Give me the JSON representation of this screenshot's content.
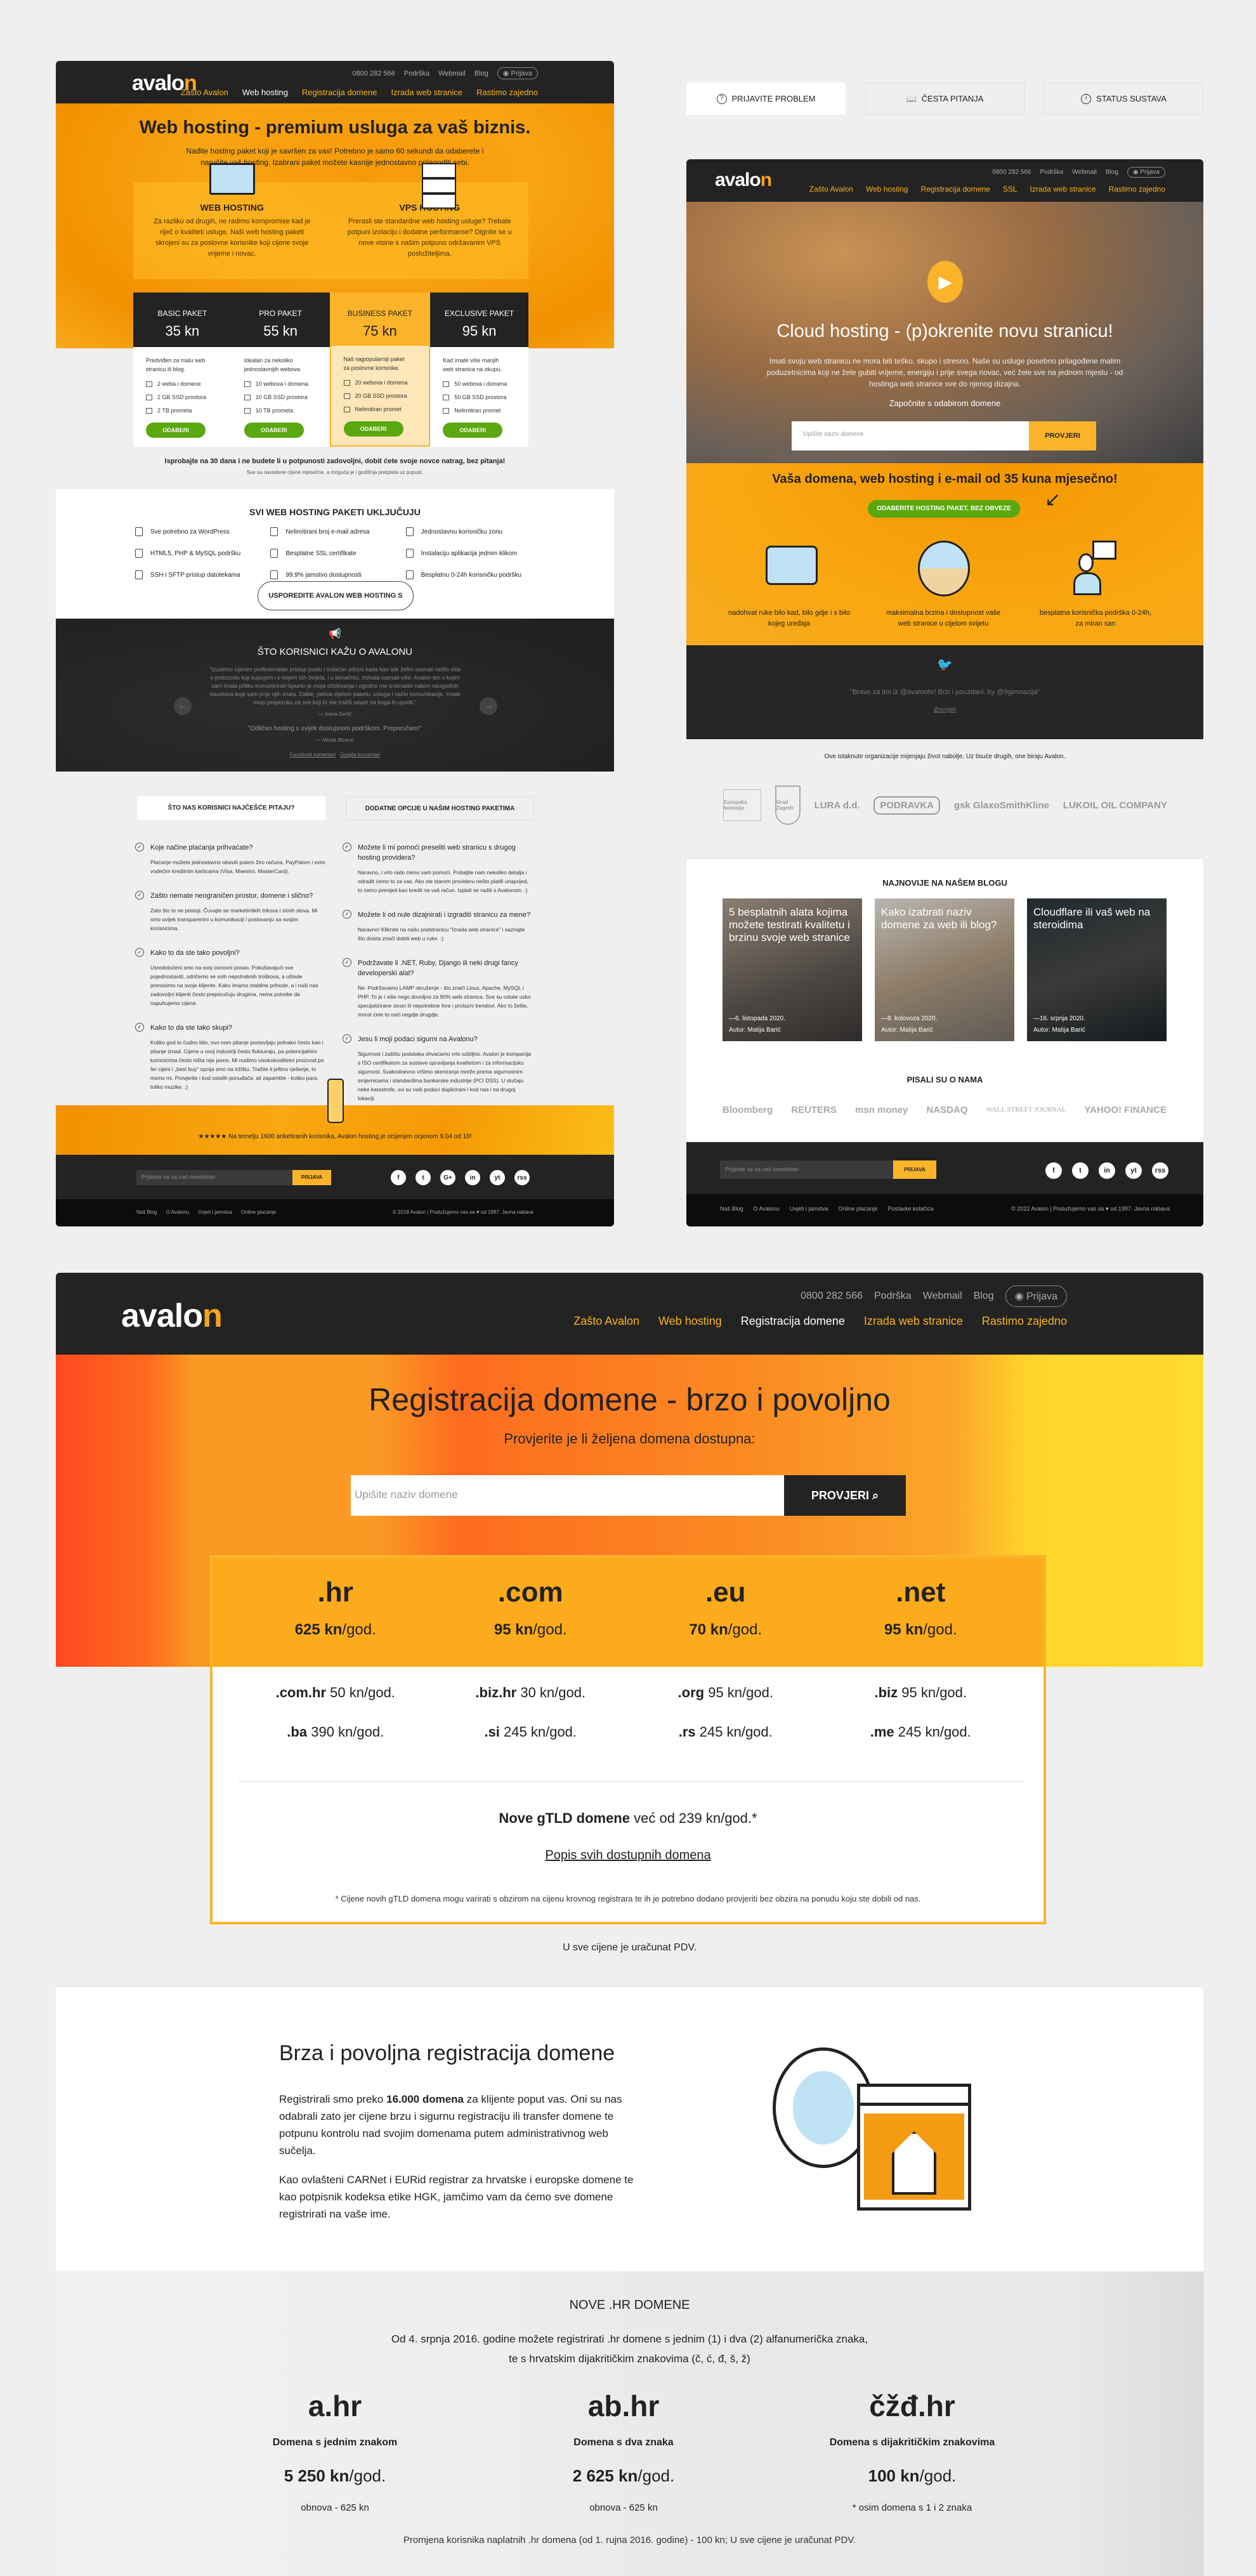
{
  "colors": {
    "brand_orange": "#f9a51a",
    "dark": "#232323",
    "green": "#5aa80f",
    "page_bg": "#efefef"
  },
  "panel_hosting": {
    "header": {
      "logo_a": "avalo",
      "logo_b": "n",
      "phone": "0800 282 566",
      "links": [
        "Podrška",
        "Webmail",
        "Blog"
      ],
      "login": "Prijava",
      "nav": [
        "Zašto Avalon",
        "Web hosting",
        "Registracija domene",
        "Izrada web stranice",
        "Rastimo zajedno"
      ],
      "active": 1
    },
    "title": "Web hosting - premium usluga za vaš biznis.",
    "subtitle": "Nađite hosting paket koji je savršen za vas! Potrebno je samo 60 sekundi da odaberete i naručite vaš hosting. Izabrani paket možete kasnije jednostavno prilagoditi sebi.",
    "options": [
      {
        "title": "WEB HOSTING",
        "text": "Za razliku od drugih, ne radimo kompromise kad je riječ o kvaliteti usluge. Naši web hosting paketi skrojeni su za poslovne korisnike koji cijene svoje vrijeme i novac.",
        "icon": "devices-icon"
      },
      {
        "title": "VPS HOSTING",
        "text": "Prerasli ste standardne web hosting usluge? Trebate potpuni izolaciju i dodatne performanse? Dignite se u nove visine s našim potpuno održavanim VPS poslužiteljima.",
        "icon": "server-icon"
      }
    ],
    "plans": [
      {
        "name": "BASIC PAKET",
        "price": "35 kn",
        "desc": "Predviđen za malu web stranicu ili blog.",
        "features": [
          "2 weba i domene",
          "2 GB SSD prostora",
          "2 TB prometa"
        ],
        "button": "ODABERI",
        "highlighted": false
      },
      {
        "name": "PRO PAKET",
        "price": "55 kn",
        "desc": "Idealan za nekoliko jednostavnijih webova.",
        "features": [
          "10 webova i domena",
          "10 GB SSD prostora",
          "10 TB prometa"
        ],
        "button": "ODABERI",
        "highlighted": false
      },
      {
        "name": "BUSINESS PAKET",
        "price": "75 kn",
        "desc": "Naš najpopularniji paket za poslovne korisnike.",
        "features": [
          "20 webova i domena",
          "20 GB SSD prostora",
          "Nelimitiran promet"
        ],
        "button": "ODABERI",
        "highlighted": true
      },
      {
        "name": "EXCLUSIVE PAKET",
        "price": "95 kn",
        "desc": "Kad imate više manjih web stranica na okupu.",
        "features": [
          "50 webova i domena",
          "50 GB SSD prostora",
          "Nelimitiran promet"
        ],
        "button": "ODABERI",
        "highlighted": false
      }
    ],
    "guarantee": "Isprobajte na 30 dana i ne budete li u potpunosti zadovoljni, dobit ćete svoje novce natrag, bez pitanja!",
    "note": "Sve su navedene cijene mjesečne, a moguća je i godišnja pretplata uz popust."
  },
  "panel_features": {
    "title": "SVI WEB HOSTING PAKETI UKLJUČUJU",
    "items": [
      "Sve potrebno za WordPress",
      "Nelimitirani broj e-mail adresa",
      "Jednostavnu korisničku zonu",
      "HTML5, PHP & MySQL podršku",
      "Besplatne SSL certifikate",
      "Instalaciju aplikacija jednim klikom",
      "SSH i SFTP pristup datotekama",
      "99,9% jamstvo dostupnosti",
      "Besplatnu 0-24h korisničku podršku"
    ],
    "compare_button": "USPOREDITE AVALON WEB HOSTING S DRUGIMA",
    "testimonials_title": "ŠTO KORISNICI KAŽU O AVALONU",
    "quote1": "\"Izuzetno cijenim profesionalan pristup poslu i srdačan odnos kada kao laik želim saznati nešto više o proizvodu koji kupujem i o kojem bih željela, i u konačnici, trebala saznati više. Avalon tim s kojim sam imala priliku komunicirati ispunio je moja očekivanja i ugodno me iznenadio nakon neugodnih iskustava koje sam prije njih imala. Dakle, petica cijelom paketu: usluga i način komunikacije. Imate moju preporuku za sve koji bi me tražili savjet na koga ih uputiti.\"",
    "author1": "— Ivana Sertić",
    "quote2": "\"Odličan hosting s uvijek dostupnom podrškom. Preporučam!\"",
    "author2": "— Nikola Bicanic",
    "fb_link": "Facebook komentari",
    "g_link": "Google komentari"
  },
  "support_buttons": [
    "PRIJAVITE PROBLEM",
    "ČESTA PITANJA",
    "STATUS SUSTAVA"
  ],
  "panel_cloud": {
    "header": {
      "logo_a": "avalo",
      "logo_b": "n",
      "phone": "0800 282 566",
      "links": [
        "Podrška",
        "Webmail",
        "Blog"
      ],
      "login": "Prijava",
      "nav": [
        "Zašto Avalon",
        "Web hosting",
        "Registracija domene",
        "SSL",
        "Izrada web stranice",
        "Rastimo zajedno"
      ]
    },
    "title": "Cloud hosting - (p)okrenite novu stranicu!",
    "text": "Imati svoju web stranicu ne mora biti teško, skupo i stresno. Naše su usluge posebno prilagođene malim poduzetnicima koji ne žele gubiti vrijeme, energiju i prije svega novac, već žele sve na jednom mjestu - od hostinga web stranice sve do njenog dizajna.",
    "label": "Započnite s odabirom domene",
    "placeholder": "Upišite naziv domene",
    "check": "PROVJERI",
    "promo": "Vaša domena, web hosting i e-mail od 35 kuna mjesečno!",
    "promo_button": "ODABERITE HOSTING PAKET, BEZ OBVEZE",
    "benefits": [
      "nadohvat ruke bilo kad, bilo gdje i s bilo kojeg uređaja",
      "maksimalna brzina i dostupnost vaše web stranice u cijelom svijetu",
      "besplatna korisnička podrška 0-24h, za miran san"
    ],
    "tweet": "\"Bravo za tim iz @avalonhr! Brzi i pouzdani. by @9gimnazija\"",
    "handle": "@sonjalr"
  },
  "clients": {
    "text": "Ove istaknute organizacije mijenjaju život nabolje. Uz tisuće drugih, one biraju Avalon.",
    "logos": [
      "Europska komisija",
      "Grad Zagreb",
      "LURA d.d.",
      "PODRAVKA",
      "gsk GlaxoSmithKline",
      "LUKOIL OIL COMPANY"
    ]
  },
  "blog": {
    "title": "NAJNOVIJE NA NAŠEM BLOGU",
    "posts": [
      {
        "title": "5 besplatnih alata kojima možete testirati kvalitetu i brzinu svoje web stranice",
        "date": "—6. listopada 2020.",
        "author": "Autor: Matija Barić"
      },
      {
        "title": "Kako izabrati naziv domene za web ili blog?",
        "date": "—8. kolovoza 2020.",
        "author": "Autor: Matija Barić"
      },
      {
        "title": "Cloudflare ili vaš web na steroidima",
        "date": "—16. srpnja 2020.",
        "author": "Autor: Matija Barić"
      }
    ],
    "press_title": "PISALI SU O NAMA",
    "press": [
      "Bloomberg",
      "REUTERS",
      "msn money",
      "NASDAQ",
      "WALL STREET JOURNAL",
      "YAHOO! FINANCE"
    ],
    "footer": {
      "placeholder": "Prijavite se za naš newsletter",
      "button": "PRIJAVA",
      "social": [
        "f",
        "t",
        "in",
        "yt",
        "rss"
      ],
      "links": [
        "Naš Blog",
        "O Avalonu",
        "Uvjeti i jamstva",
        "Online plaćanje",
        "Postavke kolačića"
      ],
      "copyright": "© 2022 Avalon | Poslužujemo vas sa ♥ od 1997.  Javna nabava"
    }
  },
  "panel_faq": {
    "tabs": [
      "ŠTO NAS KORISNICI NAJČEŠĆE PITAJU?",
      "DODATNE OPCIJE U NAŠIM HOSTING PAKETIMA"
    ],
    "left": [
      {
        "q": "Koje načine plaćanja prihvaćate?",
        "a": "Plaćanje možete jednostavno obaviti putem žiro računa, PayPalom i svim vodećim kreditnim karticama (Visa, Maestro, MasterCard)."
      },
      {
        "q": "Zašto nemate neograničen prostor, domene i slično?",
        "a": "Zato što to ne postoji. Čuvajte se marketinških trikova i sitnih slova. Mi smo uvijek transparentni u komunikaciji i poslovanju sa svojim korisnicima."
      },
      {
        "q": "Kako to da ste tako povoljni?",
        "a": "Usredotočeni smo na svoj osnovni posao. Pokušavajući sve pojednostaviti, odričemo se svih nepotrebnih troškova, a uštede prenosimo na svoje klijente. Kako imamo stabilne prihode, a i naši nas zadovoljni klijenti često preporučuju drugima, nema potrebe da napuhujemo cijene."
      },
      {
        "q": "Kako to da ste tako skupi?",
        "a": "Koliko god to čudno bilo, ovo nam pitanje postavljaju jednako često kao i pitanje iznad. Cijene u ovoj industriji često fluktuiraju, pa potencijalnim korisnicima često ništa nije jasno. Mi nudimo visokokvalitetni proizvod po fer cijeni i „best buy” opcija smo na tržištu. Tražite li jeftino rješenje, to nismo mi. Provjerite i kod ostalih ponuđača, ali zapamtite - koliko para, toliko muzike. ;)"
      }
    ],
    "right": [
      {
        "q": "Možete li mi pomoći preseliti web stranicu s drugog hosting providera?",
        "a": "Naravno, i vrlo rado ćemo vam pomoći. Pošaljite nam nekoliko detalja i odradit ćemo to za vas. Ako ste starom provideru nešto platili unaprijed, to ćemo prenijeti kao kredit na vaš račun. Isplati se raditi s Avalonom. :)"
      },
      {
        "q": "Možete li od nule dizajnirati i izgraditi stranicu za mene?",
        "a": "Naravno! Kliknite na našu podstranicu \"Izrada web stranice\" i saznajte što doista znači dobiti web u ruke. :)"
      },
      {
        "q": "Podržavate li .NET, Ruby, Django ili neki drugi fancy developerski alat?",
        "a": "Ne. Podržavamo LAMP okruženje - što znači Linux, Apache, MySQL i PHP. To je i više nego dovoljno za 90% web stranica. Sve su ostale usko specijalizirane stvari ili nepotrebne fore i prolazni trendovi. Ako to želite, morat ćete to naći negdje drugdje."
      },
      {
        "q": "Jesu li moji podaci sigurni na Avalonu?",
        "a": "Sigurnost i zaštitu podataka shvaćamo vrlo ozbiljno. Avalon je kompanija s ISO certifikatom za sustave upravljanja kvalitetom i za informacijsku sigurnost. Svakodnevno vršimo skeniranja mreže prema sigurnosnim smjernicama i standardima bankarske industrije (PCI DSS). U slučaju neke katastrofe, svi su vaši podaci duplicirani i kod nas i na drugoj lokaciji."
      }
    ],
    "stars": "★★★★★",
    "rating": "Na temelju 1600 anketiranih korisnika, Avalon hosting je ocijenjen ocjenom 9,04 od 10!",
    "footer": {
      "placeholder": "Prijavite se za naš newsletter",
      "button": "PRIJAVA",
      "social": [
        "f",
        "t",
        "G+",
        "in",
        "yt",
        "rss"
      ],
      "links": [
        "Naš Blog",
        "O Avalonu",
        "Uvjeti i jamstva",
        "Online plaćanje"
      ],
      "copyright": "© 2018 Avalon | Poslužujemo vas sa ♥ od 1997.  Javna nabava"
    }
  },
  "panel_domains": {
    "header": {
      "logo_a": "avalo",
      "logo_b": "n",
      "phone": "0800 282 566",
      "links": [
        "Podrška",
        "Webmail",
        "Blog"
      ],
      "login": "Prijava",
      "nav": [
        "Zašto Avalon",
        "Web hosting",
        "Registracija domene",
        "Izrada web stranice",
        "Rastimo zajedno"
      ],
      "active": 2
    },
    "title": "Registracija domene - brzo i povoljno",
    "subtitle": "Provjerite je li željena domena dostupna:",
    "placeholder": "Upišite naziv domene",
    "check": "PROVJERI",
    "main_tlds": [
      {
        "tld": ".hr",
        "price": "625 kn",
        "unit": "/god."
      },
      {
        "tld": ".com",
        "price": "95 kn",
        "unit": "/god."
      },
      {
        "tld": ".eu",
        "price": "70 kn",
        "unit": "/god."
      },
      {
        "tld": ".net",
        "price": "95 kn",
        "unit": "/god."
      }
    ],
    "other_tlds": [
      {
        "tld": ".com.hr",
        "price": "50 kn/god."
      },
      {
        "tld": ".biz.hr",
        "price": "30 kn/god."
      },
      {
        "tld": ".org",
        "price": "95 kn/god."
      },
      {
        "tld": ".biz",
        "price": "95 kn/god."
      },
      {
        "tld": ".ba",
        "price": "390 kn/god."
      },
      {
        "tld": ".si",
        "price": "245 kn/god."
      },
      {
        "tld": ".rs",
        "price": "245 kn/god."
      },
      {
        "tld": ".me",
        "price": "245 kn/god."
      }
    ],
    "gtld_bold": "Nove gTLD domene",
    "gtld_rest": "već od 239 kn/god.*",
    "all_link": "Popis svih dostupnih domena",
    "footnote": "* Cijene novih gTLD domena mogu varirati s obzirom na cijenu krovnog registrara te ih je potrebno dodano provjeriti bez obzira na ponudu koju ste dobili od nas.",
    "vat": "U sve cijene je uračunat PDV.",
    "about_title": "Brza i povoljna registracija domene",
    "p1_a": "Registrirali smo preko ",
    "p1_b": "16.000 domena",
    "p1_c": " za klijente poput vas. Oni su nas odabrali zato jer cijene brzu i sigurnu registraciju ili transfer domene te potpunu kontrolu nad svojim domenama putem administrativnog web sučelja.",
    "p2": "Kao ovlašteni CARNet i EURid registrar za hrvatske i europske domene te kao potpisnik kodeksa etike HGK, jamčimo vam da ćemo sve domene registrirati na vaše ime.",
    "new_title": "NOVE .HR DOMENE",
    "new_text1": "Od 4. srpnja 2016. godine možete registrirati .hr domene s jednim (1) i dva (2) alfanumerička znaka,",
    "new_text2": "te s hrvatskim dijakritičkim znakovima (č, ć, đ, š, ž)",
    "new_items": [
      {
        "domain": "a.hr",
        "label": "Domena s jednim znakom",
        "price": "5 250 kn",
        "unit": "/god.",
        "note": "obnova - 625 kn"
      },
      {
        "domain": "ab.hr",
        "label": "Domena s dva znaka",
        "price": "2 625 kn",
        "unit": "/god.",
        "note": "obnova - 625 kn"
      },
      {
        "domain": "čžđ.hr",
        "label": "Domena s dijakritičkim znakovima",
        "price": "100 kn",
        "unit": "/god.",
        "note": "* osim domena s 1 i 2 znaka"
      }
    ],
    "bottom_note": "Promjena korisnika naplatnih .hr domena (od 1. rujna 2016. godine) - 100 kn; U sve cijene je uračunat PDV."
  }
}
